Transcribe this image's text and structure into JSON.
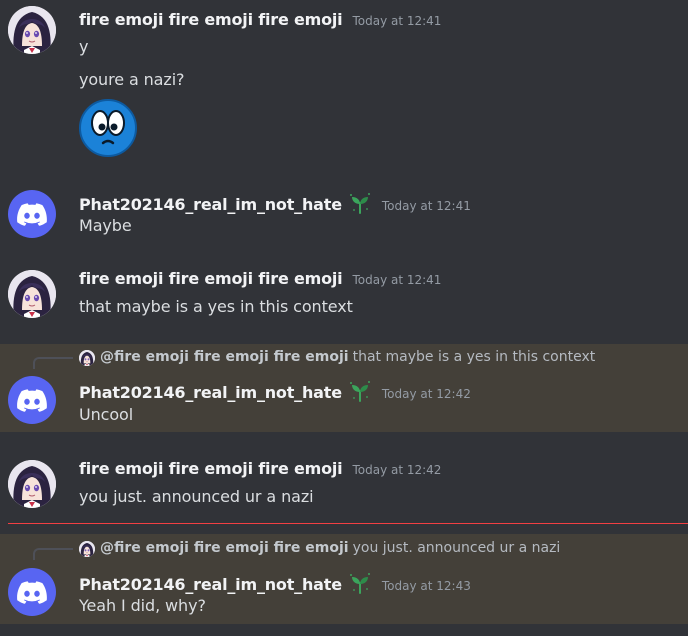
{
  "colors": {
    "background": "#313338",
    "highlight": "#444039",
    "username": "#f2f3f5",
    "timestamp": "#949ba4",
    "text": "#dbdee1",
    "discord_blurple": "#5865f2",
    "new_divider": "#f23f43",
    "sprout_green": "#3ba55c"
  },
  "messages": [
    {
      "author": "fire emoji fire emoji fire emoji",
      "timestamp": "Today at 12:41",
      "lines": [
        "y",
        "youre a nazi?"
      ],
      "attachment": "surprised-face-emoji"
    },
    {
      "author": "Phat202146_real_im_not_hate",
      "timestamp": "Today at 12:41",
      "badge": "sprout-icon",
      "lines": [
        "Maybe"
      ]
    },
    {
      "author": "fire emoji fire emoji fire emoji",
      "timestamp": "Today at 12:41",
      "lines": [
        "that maybe is a yes in this context"
      ]
    },
    {
      "reply": {
        "author": "@fire emoji fire emoji fire emoji",
        "text": "that maybe is a yes in this context"
      },
      "author": "Phat202146_real_im_not_hate",
      "timestamp": "Today at 12:42",
      "badge": "sprout-icon",
      "lines": [
        "Uncool"
      ]
    },
    {
      "author": "fire emoji fire emoji fire emoji",
      "timestamp": "Today at 12:42",
      "lines": [
        "you just. announced ur a nazi"
      ]
    },
    {
      "reply": {
        "author": "@fire emoji fire emoji fire emoji",
        "text": "you just. announced ur a nazi"
      },
      "author": "Phat202146_real_im_not_hate",
      "timestamp": "Today at 12:43",
      "badge": "sprout-icon",
      "lines": [
        "Yeah I did, why?"
      ]
    }
  ]
}
